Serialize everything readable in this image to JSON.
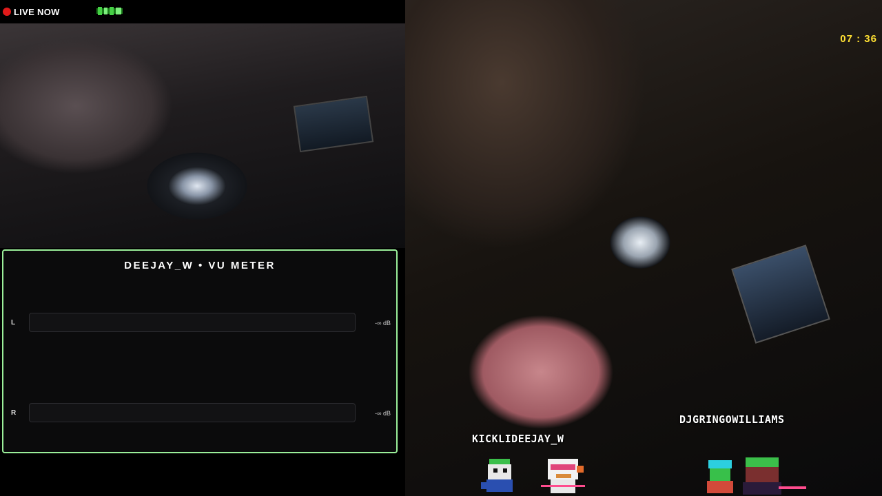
{
  "status": {
    "live_label": "LIVE NOW",
    "live_color": "#e01a1a",
    "badge_icon": "green-pixel-logo-icon"
  },
  "clock": {
    "time": "07 : 36",
    "color": "#ffe033"
  },
  "vu_meter": {
    "title": "DEEJAY_W • VU METER",
    "border_color": "#9bf09a",
    "channels": [
      {
        "label": "L",
        "db": "-∞ dB",
        "level": 0
      },
      {
        "label": "R",
        "db": "-∞ dB",
        "level": 0
      }
    ]
  },
  "overlays": {
    "left_user": "KICKLIDEEJAY_W",
    "right_user": "DJGRINGOWILLIAMS"
  }
}
